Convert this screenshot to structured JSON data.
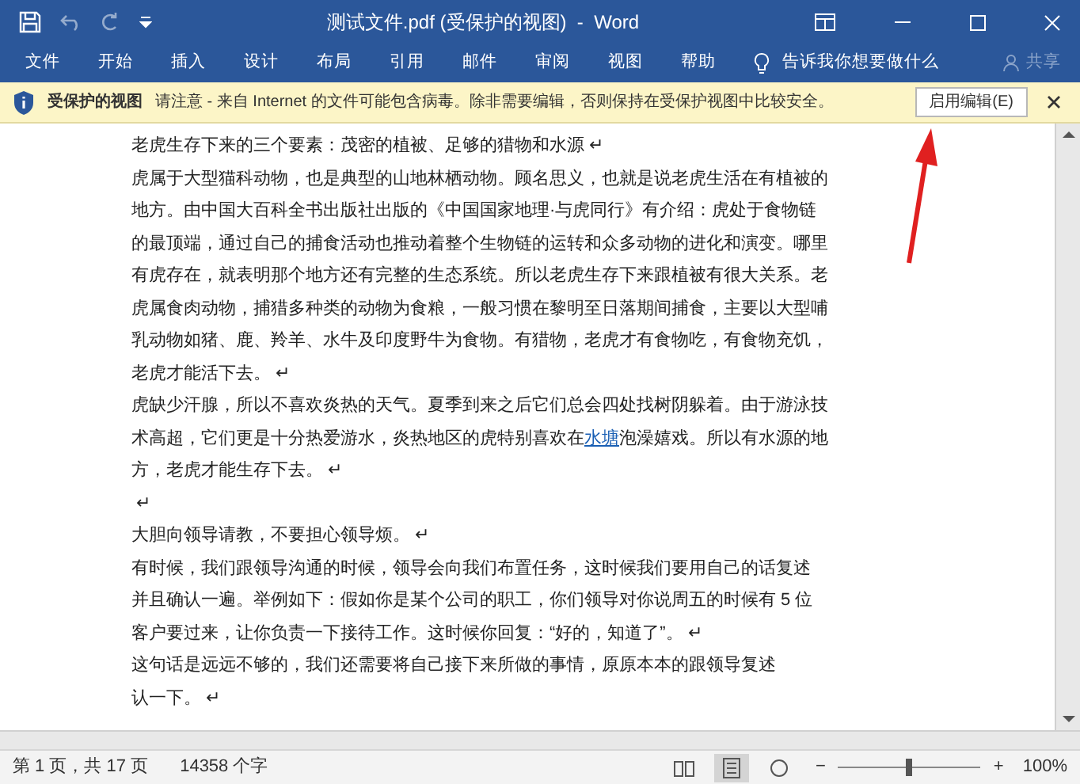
{
  "window": {
    "title": "测试文件.pdf (受保护的视图)  -  Word"
  },
  "ribbon_tabs": [
    {
      "label": "文件",
      "selected": false
    },
    {
      "label": "开始",
      "selected": false
    },
    {
      "label": "插入",
      "selected": false
    },
    {
      "label": "设计",
      "selected": false
    },
    {
      "label": "布局",
      "selected": false
    },
    {
      "label": "引用",
      "selected": false
    },
    {
      "label": "邮件",
      "selected": false
    },
    {
      "label": "审阅",
      "selected": false
    },
    {
      "label": "视图",
      "selected": false
    },
    {
      "label": "帮助",
      "selected": false
    }
  ],
  "tell_me": "告诉我你想要做什么",
  "share": {
    "label": "共享",
    "disabled": true
  },
  "protected_bar": {
    "title": "受保护的视图",
    "message": "请注意 - 来自 Internet 的文件可能包含病毒。除非需要编辑，否则保持在受保护视图中比较安全。",
    "button": "启用编辑(E)"
  },
  "document": {
    "lines": [
      [
        {
          "kind": "text",
          "text": "老虎生存下来的三个要素：茂密的植被、足够的猎物和水源 ↵"
        }
      ],
      [
        {
          "kind": "text",
          "text": "虎属于大型猫科动物，也是典型的山地林栖动物。顾名思义，也就是说老虎生活在有植被的"
        }
      ],
      [
        {
          "kind": "text",
          "text": "地方。由中国大百科全书出版社出版的《中国国家地理·与虎同行》有介绍：虎处于食物链"
        }
      ],
      [
        {
          "kind": "text",
          "text": "的最顶端，通过自己的捕食活动也推动着整个生物链的运转和众多动物的进化和演变。哪里"
        }
      ],
      [
        {
          "kind": "text",
          "text": "有虎存在，就表明那个地方还有完整的生态系统。所以老虎生存下来跟植被有很大关系。老"
        }
      ],
      [
        {
          "kind": "text",
          "text": "虎属食肉动物，捕猎多种类的动物为食粮，一般习惯在黎明至日落期间捕食，主要以大型哺"
        }
      ],
      [
        {
          "kind": "text",
          "text": "乳动物如猪、鹿、羚羊、水牛及印度野牛为食物。有猎物，老虎才有食物吃，有食物充饥，"
        }
      ],
      [
        {
          "kind": "text",
          "text": "老虎才能活下去。 ↵"
        }
      ],
      [
        {
          "kind": "text",
          "text": "虎缺少汗腺，所以不喜欢炎热的天气。夏季到来之后它们总会四处找树阴躲着。由于游泳技"
        }
      ],
      [
        {
          "kind": "text",
          "text": "术高超，它们更是十分热爱游水，炎热地区的虎特别喜欢在"
        },
        {
          "kind": "link",
          "text": "水塘"
        },
        {
          "kind": "text",
          "text": "泡澡嬉戏。所以有水源的地"
        }
      ],
      [
        {
          "kind": "text",
          "text": "方，老虎才能生存下去。 ↵"
        }
      ],
      [
        {
          "kind": "text",
          "text": " ↵"
        }
      ],
      [
        {
          "kind": "text",
          "text": "大胆向领导请教，不要担心领导烦。 ↵"
        }
      ],
      [
        {
          "kind": "text",
          "text": "有时候，我们跟领导沟通的时候，领导会向我们布置任务，这时候我们要用自己的话复述"
        }
      ],
      [
        {
          "kind": "text",
          "text": "并且确认一遍。举例如下：假如你是某个公司的职工，你们领导对你说周五的时候有 5 位"
        }
      ],
      [
        {
          "kind": "text",
          "text": "客户要过来，让你负责一下接待工作。这时候你回复：“好的，知道了”。 ↵"
        }
      ],
      [
        {
          "kind": "text",
          "text": "这句话是远远不够的，我们还需要将自己接下来所做的事情，原原本本的跟领导复述"
        }
      ],
      [
        {
          "kind": "text",
          "text": "认一下。 ↵"
        }
      ]
    ]
  },
  "status_bar": {
    "page": "第 1 页，共 17 页",
    "words": "14358 个字",
    "zoom": {
      "out": "−",
      "in": "+",
      "level": 0.5,
      "label": "100%"
    }
  }
}
